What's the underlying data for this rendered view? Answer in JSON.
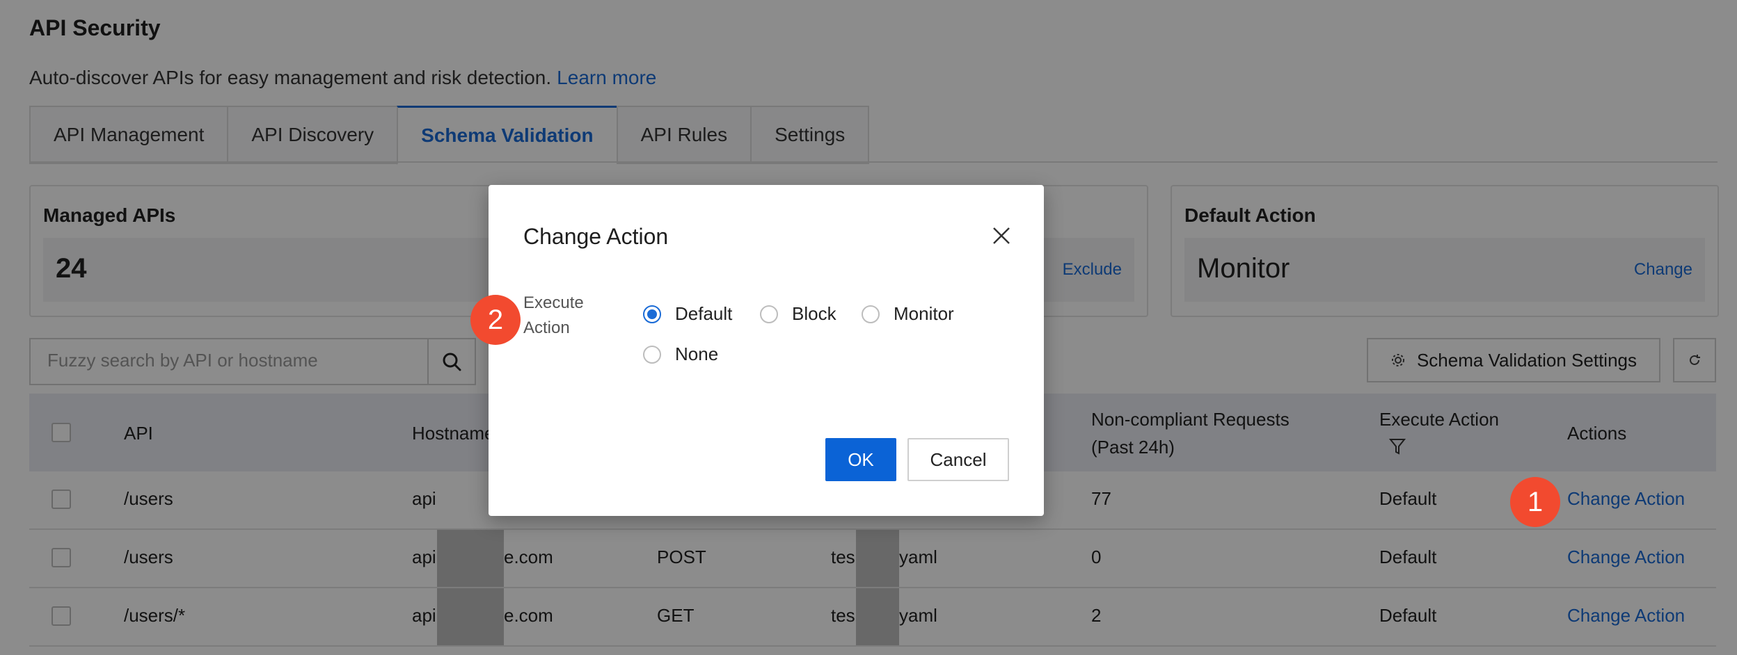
{
  "page": {
    "title": "API Security",
    "subtitle": "Auto-discover APIs for easy management and risk detection.",
    "learn_more": "Learn more"
  },
  "tabs": [
    {
      "label": "API Management",
      "active": false
    },
    {
      "label": "API Discovery",
      "active": false
    },
    {
      "label": "Schema Validation",
      "active": true
    },
    {
      "label": "API Rules",
      "active": false
    },
    {
      "label": "Settings",
      "active": false
    }
  ],
  "cards": {
    "managed": {
      "title": "Managed APIs",
      "value": "24"
    },
    "middle": {
      "action": "Exclude"
    },
    "default_action": {
      "title": "Default Action",
      "value": "Monitor",
      "action": "Change"
    }
  },
  "search": {
    "placeholder": "Fuzzy search by API or hostname"
  },
  "toolbar": {
    "schema_settings": "Schema Validation Settings"
  },
  "table": {
    "headers": {
      "api": "API",
      "hostname": "Hostname",
      "noncompliant_line1": "Non-compliant Requests",
      "noncompliant_line2": "(Past 24h)",
      "execute_action": "Execute Action",
      "actions": "Actions"
    },
    "rows": [
      {
        "api": "/users",
        "hostname": "api",
        "method": "",
        "schema": "",
        "noncompliant": "77",
        "execute": "Default",
        "action": "Change Action"
      },
      {
        "api": "/users",
        "hostname_left": "api",
        "hostname_right": "e.com",
        "method": "POST",
        "schema_left": "tes",
        "schema_right": "yaml",
        "noncompliant": "0",
        "execute": "Default",
        "action": "Change Action"
      },
      {
        "api": "/users/*",
        "hostname_left": "api",
        "hostname_right": "e.com",
        "method": "GET",
        "schema_left": "tes",
        "schema_right": "yaml",
        "noncompliant": "2",
        "execute": "Default",
        "action": "Change Action"
      }
    ]
  },
  "modal": {
    "title": "Change Action",
    "field_label_line1": "Execute",
    "field_label_line2": "Action",
    "options": [
      {
        "label": "Default",
        "checked": true
      },
      {
        "label": "Block",
        "checked": false
      },
      {
        "label": "Monitor",
        "checked": false
      },
      {
        "label": "None",
        "checked": false
      }
    ],
    "ok": "OK",
    "cancel": "Cancel"
  },
  "annotations": {
    "step1": "1",
    "step2": "2",
    "color": "#f24a2f"
  },
  "colors": {
    "accent": "#1a6bd6",
    "primary_button": "#0b63d6"
  }
}
